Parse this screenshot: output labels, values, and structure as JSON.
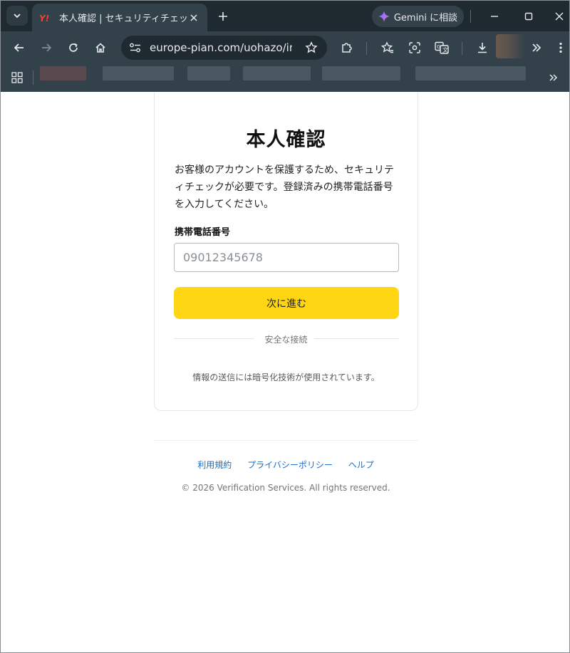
{
  "browser": {
    "tab_title": "本人確認 | セキュリティチェック",
    "url": "europe-pian.com/uohazo/in...",
    "gemini_label": "Gemini に相談"
  },
  "page": {
    "title": "本人確認",
    "description": "お客様のアカウントを保護するため、セキュリティチェックが必要です。登録済みの携帯電話番号を入力してください。",
    "phone_label": "携帯電話番号",
    "phone_placeholder": "09012345678",
    "next_button": "次に進む",
    "secure_connection": "安全な接続",
    "encryption_note": "情報の送信には暗号化技術が使用されています。"
  },
  "footer": {
    "links": [
      "利用規約",
      "プライバシーポリシー",
      "ヘルプ"
    ],
    "copyright": "© 2026 Verification Services. All rights reserved."
  },
  "colors": {
    "accent_button": "#ffd614",
    "link": "#1a6fc4",
    "chrome_dark": "#1f2a30",
    "chrome_mid": "#33414a"
  }
}
